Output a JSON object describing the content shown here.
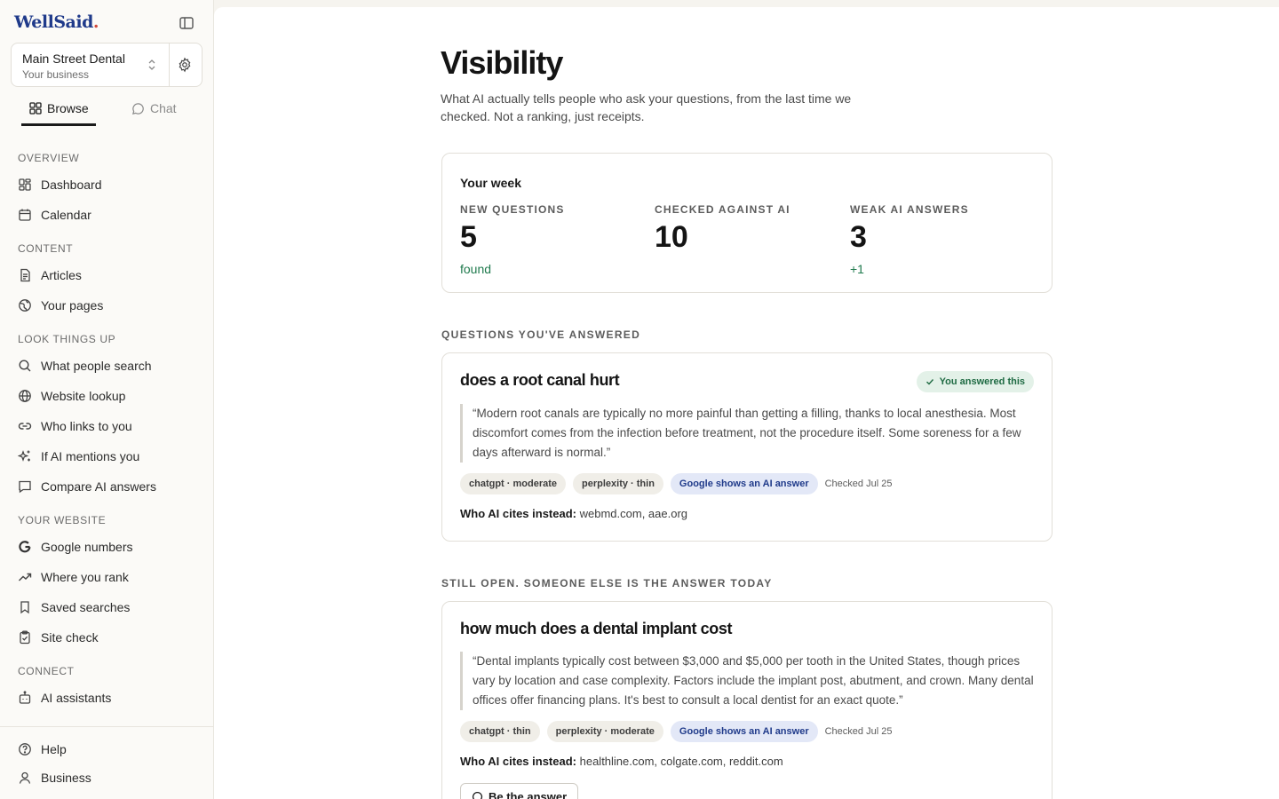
{
  "brand": {
    "name": "WellSaid",
    "dot": "."
  },
  "business": {
    "name": "Main Street Dental",
    "sub": "Your business"
  },
  "tabs": [
    {
      "label": "Browse",
      "active": true
    },
    {
      "label": "Chat",
      "active": false
    }
  ],
  "sidebar": {
    "sections": [
      {
        "title": "OVERVIEW",
        "items": [
          {
            "label": "Dashboard",
            "icon": "dashboard-icon"
          },
          {
            "label": "Calendar",
            "icon": "calendar-icon"
          }
        ]
      },
      {
        "title": "CONTENT",
        "items": [
          {
            "label": "Articles",
            "icon": "document-icon"
          },
          {
            "label": "Your pages",
            "icon": "globe-icon"
          }
        ]
      },
      {
        "title": "LOOK THINGS UP",
        "items": [
          {
            "label": "What people search",
            "icon": "search-icon"
          },
          {
            "label": "Website lookup",
            "icon": "globe-icon"
          },
          {
            "label": "Who links to you",
            "icon": "link-icon"
          },
          {
            "label": "If AI mentions you",
            "icon": "sparkle-icon"
          },
          {
            "label": "Compare AI answers",
            "icon": "chat-icon"
          }
        ]
      },
      {
        "title": "YOUR WEBSITE",
        "items": [
          {
            "label": "Google numbers",
            "icon": "google-icon"
          },
          {
            "label": "Where you rank",
            "icon": "trend-icon"
          },
          {
            "label": "Saved searches",
            "icon": "bookmark-icon"
          },
          {
            "label": "Site check",
            "icon": "clipboard-check-icon"
          }
        ]
      },
      {
        "title": "CONNECT",
        "items": [
          {
            "label": "AI assistants",
            "icon": "bot-icon"
          }
        ]
      }
    ],
    "footer": [
      {
        "label": "Help",
        "icon": "help-icon"
      },
      {
        "label": "Business",
        "icon": "user-icon"
      }
    ]
  },
  "page": {
    "title": "Visibility",
    "subtitle": "What AI actually tells people who ask your questions, from the last time we checked. Not a ranking, just receipts."
  },
  "week": {
    "title": "Your week",
    "stats": [
      {
        "label": "NEW QUESTIONS",
        "value": "5",
        "note": "found"
      },
      {
        "label": "CHECKED AGAINST AI",
        "value": "10",
        "note": ""
      },
      {
        "label": "WEAK AI ANSWERS",
        "value": "3",
        "note": "+1"
      }
    ]
  },
  "answered": {
    "header": "QUESTIONS YOU'VE ANSWERED",
    "card": {
      "question": "does a root canal hurt",
      "badge": "You answered this",
      "quote": "“Modern root canals are typically no more painful than getting a filling, thanks to local anesthesia. Most discomfort comes from the infection before treatment, not the procedure itself. Some soreness for a few days afterward is normal.”",
      "chips": [
        "chatgpt · moderate",
        "perplexity · thin",
        "Google shows an AI answer"
      ],
      "checked": "Checked Jul 25",
      "cites_label": "Who AI cites instead:",
      "cites": "webmd.com, aae.org"
    }
  },
  "open": {
    "header": "STILL OPEN. SOMEONE ELSE IS THE ANSWER TODAY",
    "card": {
      "question": "how much does a dental implant cost",
      "quote": "“Dental implants typically cost between $3,000 and $5,000 per tooth in the United States, though prices vary by location and case complexity. Factors include the implant post, abutment, and crown. Many dental offices offer financing plans. It's best to consult a local dentist for an exact quote.”",
      "chips": [
        "chatgpt · thin",
        "perplexity · moderate",
        "Google shows an AI answer"
      ],
      "checked": "Checked Jul 25",
      "cites_label": "Who AI cites instead:",
      "cites": "healthline.com, colgate.com, reddit.com",
      "button": "Be the answer"
    }
  },
  "colors": {
    "accent": "#1f3a8a",
    "success": "#1f7a4d",
    "brand_dot": "#d1493b"
  }
}
